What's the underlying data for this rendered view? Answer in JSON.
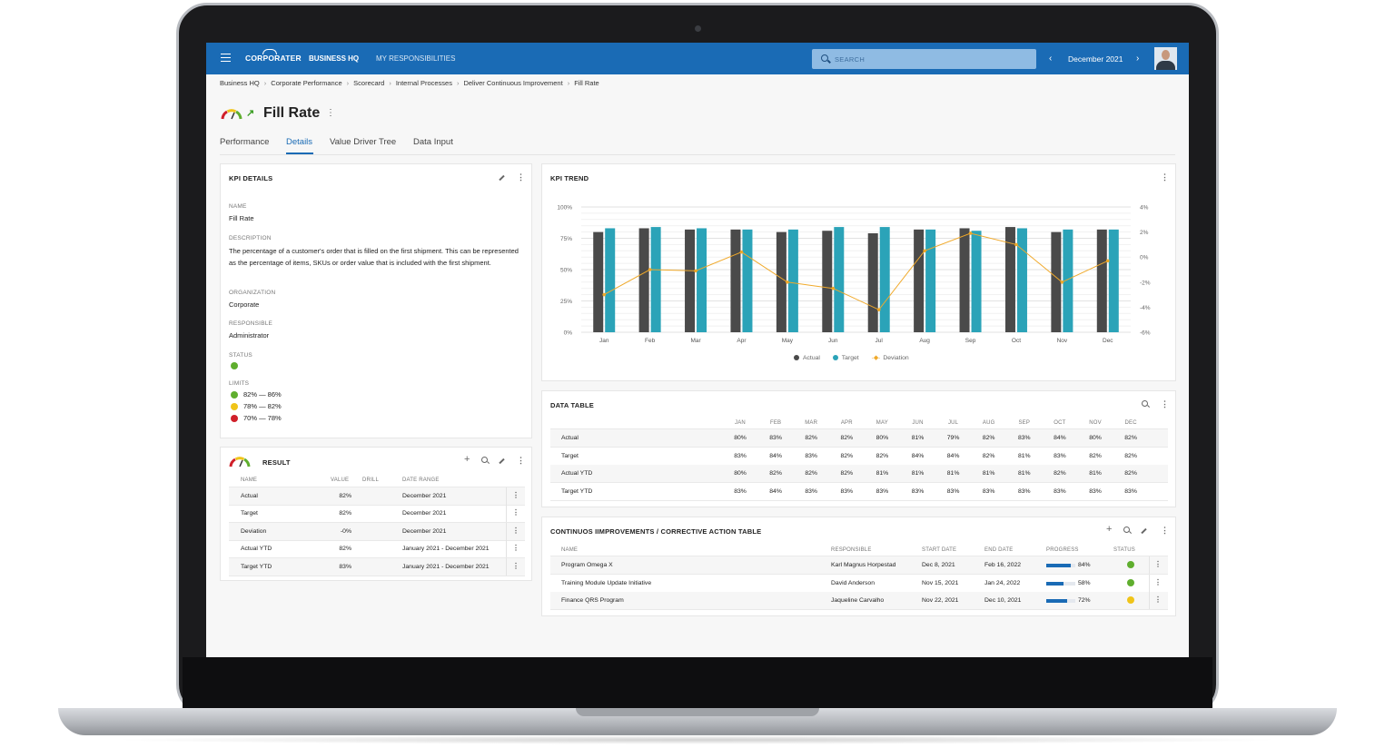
{
  "header": {
    "logo": "CORPORATER",
    "nav": [
      "BUSINESS HQ",
      "MY RESPONSIBILITIES"
    ],
    "search_placeholder": "SEARCH",
    "period": "December 2021"
  },
  "breadcrumb": [
    "Business HQ",
    "Corporate Performance",
    "Scorecard",
    "Internal Processes",
    "Deliver Continuous Improvement",
    "Fill Rate"
  ],
  "page": {
    "title": "Fill Rate",
    "tabs": [
      "Performance",
      "Details",
      "Value Driver Tree",
      "Data Input"
    ],
    "active_tab": "Details"
  },
  "kpi_details": {
    "title": "KPI DETAILS",
    "name_label": "NAME",
    "name": "Fill Rate",
    "description_label": "DESCRIPTION",
    "description": "The percentage of a customer's order that is filled on the first shipment. This can be represented as the percentage of items, SKUs or order value that is included with the first shipment.",
    "organization_label": "ORGANIZATION",
    "organization": "Corporate",
    "responsible_label": "RESPONSIBLE",
    "responsible": "Administrator",
    "status_label": "STATUS",
    "status_color": "#5fae2e",
    "limits_label": "LIMITS",
    "limits": [
      {
        "range": "82% — 86%",
        "color": "#5fae2e"
      },
      {
        "range": "78% — 82%",
        "color": "#f0c419"
      },
      {
        "range": "70% — 78%",
        "color": "#d0202a"
      }
    ]
  },
  "result": {
    "title": "RESULT",
    "columns": [
      "NAME",
      "VALUE",
      "DRILL",
      "DATE RANGE"
    ],
    "rows": [
      {
        "name": "Actual",
        "value": "82%",
        "range": "December 2021"
      },
      {
        "name": "Target",
        "value": "82%",
        "range": "December 2021"
      },
      {
        "name": "Deviation",
        "value": "-0%",
        "range": "December 2021"
      },
      {
        "name": "Actual YTD",
        "value": "82%",
        "range": "January 2021 - December 2021"
      },
      {
        "name": "Target YTD",
        "value": "83%",
        "range": "January 2021 - December 2021"
      }
    ]
  },
  "kpi_trend": {
    "title": "KPI TREND"
  },
  "chart_data": {
    "type": "bar",
    "categories": [
      "Jan",
      "Feb",
      "Mar",
      "Apr",
      "May",
      "Jun",
      "Jul",
      "Aug",
      "Sep",
      "Oct",
      "Nov",
      "Dec"
    ],
    "series": [
      {
        "name": "Actual",
        "type": "bar",
        "color": "#4a4a4a",
        "values": [
          80,
          83,
          82,
          82,
          80,
          81,
          79,
          82,
          83,
          84,
          80,
          82
        ]
      },
      {
        "name": "Target",
        "type": "bar",
        "color": "#2ba3b8",
        "values": [
          83,
          84,
          83,
          82,
          82,
          84,
          84,
          82,
          81,
          83,
          82,
          82
        ]
      },
      {
        "name": "Deviation",
        "type": "line",
        "axis": "right",
        "color": "#f0a92a",
        "values": [
          -3,
          -1,
          -1.1,
          0.4,
          -2,
          -2.5,
          -4.2,
          0.5,
          1.9,
          1,
          -2,
          -0.3
        ]
      }
    ],
    "y_left": {
      "ticks": [
        "0%",
        "25%",
        "50%",
        "75%",
        "100%"
      ],
      "range": [
        0,
        100
      ]
    },
    "y_right": {
      "ticks": [
        "-6%",
        "-4%",
        "-2%",
        "0%",
        "2%",
        "4%"
      ],
      "range": [
        -6,
        4
      ]
    },
    "grid": true,
    "legend": "bottom"
  },
  "data_table": {
    "title": "DATA TABLE",
    "months": [
      "JAN",
      "FEB",
      "MAR",
      "APR",
      "MAY",
      "JUN",
      "JUL",
      "AUG",
      "SEP",
      "OCT",
      "NOV",
      "DEC"
    ],
    "rows": [
      {
        "name": "Actual",
        "values": [
          "80%",
          "83%",
          "82%",
          "82%",
          "80%",
          "81%",
          "79%",
          "82%",
          "83%",
          "84%",
          "80%",
          "82%"
        ]
      },
      {
        "name": "Target",
        "values": [
          "83%",
          "84%",
          "83%",
          "82%",
          "82%",
          "84%",
          "84%",
          "82%",
          "81%",
          "83%",
          "82%",
          "82%"
        ]
      },
      {
        "name": "Actual YTD",
        "values": [
          "80%",
          "82%",
          "82%",
          "82%",
          "81%",
          "81%",
          "81%",
          "81%",
          "81%",
          "82%",
          "81%",
          "82%"
        ]
      },
      {
        "name": "Target YTD",
        "values": [
          "83%",
          "84%",
          "83%",
          "83%",
          "83%",
          "83%",
          "83%",
          "83%",
          "83%",
          "83%",
          "83%",
          "83%"
        ]
      }
    ]
  },
  "actions": {
    "title": "CONTINUOS IIMPROVEMENTS / CORRECTIVE ACTION TABLE",
    "columns": [
      "NAME",
      "RESPONSIBLE",
      "START DATE",
      "END DATE",
      "PROGRESS",
      "STATUS"
    ],
    "rows": [
      {
        "name": "Program Omega X",
        "responsible": "Karl Magnus Horpestad",
        "start": "Dec 8, 2021",
        "end": "Feb 16, 2022",
        "progress": 84,
        "progress_label": "84%",
        "status_color": "#5fae2e"
      },
      {
        "name": "Training Module Update Initiative",
        "responsible": "David Anderson",
        "start": "Nov 15, 2021",
        "end": "Jan 24, 2022",
        "progress": 58,
        "progress_label": "58%",
        "status_color": "#5fae2e"
      },
      {
        "name": "Finance QRS Program",
        "responsible": "Jaqueline Carvalho",
        "start": "Nov 22, 2021",
        "end": "Dec 10, 2021",
        "progress": 72,
        "progress_label": "72%",
        "status_color": "#f0c419"
      }
    ]
  }
}
